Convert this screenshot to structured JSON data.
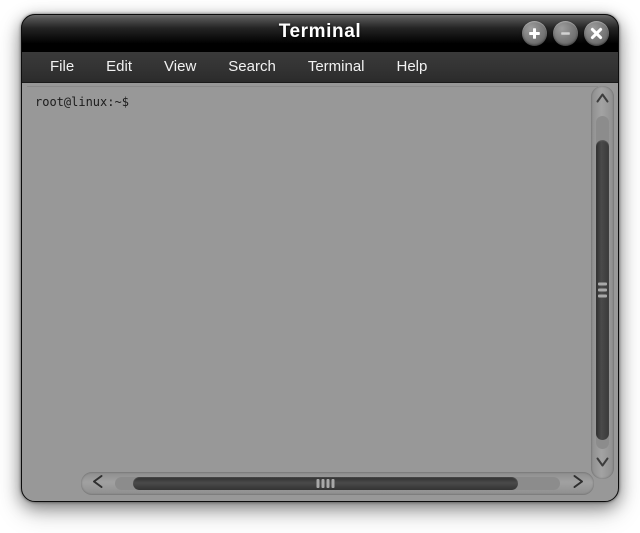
{
  "window": {
    "title": "Terminal",
    "controls": [
      {
        "name": "maximize-button",
        "glyph": "plus"
      },
      {
        "name": "minimize-button",
        "glyph": "minus"
      },
      {
        "name": "close-button",
        "glyph": "cross"
      }
    ]
  },
  "menubar": {
    "items": [
      {
        "label": "File"
      },
      {
        "label": "Edit"
      },
      {
        "label": "View"
      },
      {
        "label": "Search"
      },
      {
        "label": "Terminal"
      },
      {
        "label": "Help"
      }
    ]
  },
  "terminal": {
    "prompt": "root@linux:~$",
    "content": "root@linux:~$",
    "background_color": "#989898",
    "text_color": "#1c1c1c"
  },
  "scrollbars": {
    "vertical": {
      "up_arrow": "∧",
      "down_arrow": "∨"
    },
    "horizontal": {
      "left_arrow": "<",
      "right_arrow": ">"
    }
  },
  "colors": {
    "titlebar_top": "#3b3b3b",
    "titlebar_bottom": "#000000",
    "menubar": "#333333",
    "terminal_bg": "#989898",
    "scrollbar_thumb": "#3a3a3a",
    "page_bg": "#ffffff"
  }
}
